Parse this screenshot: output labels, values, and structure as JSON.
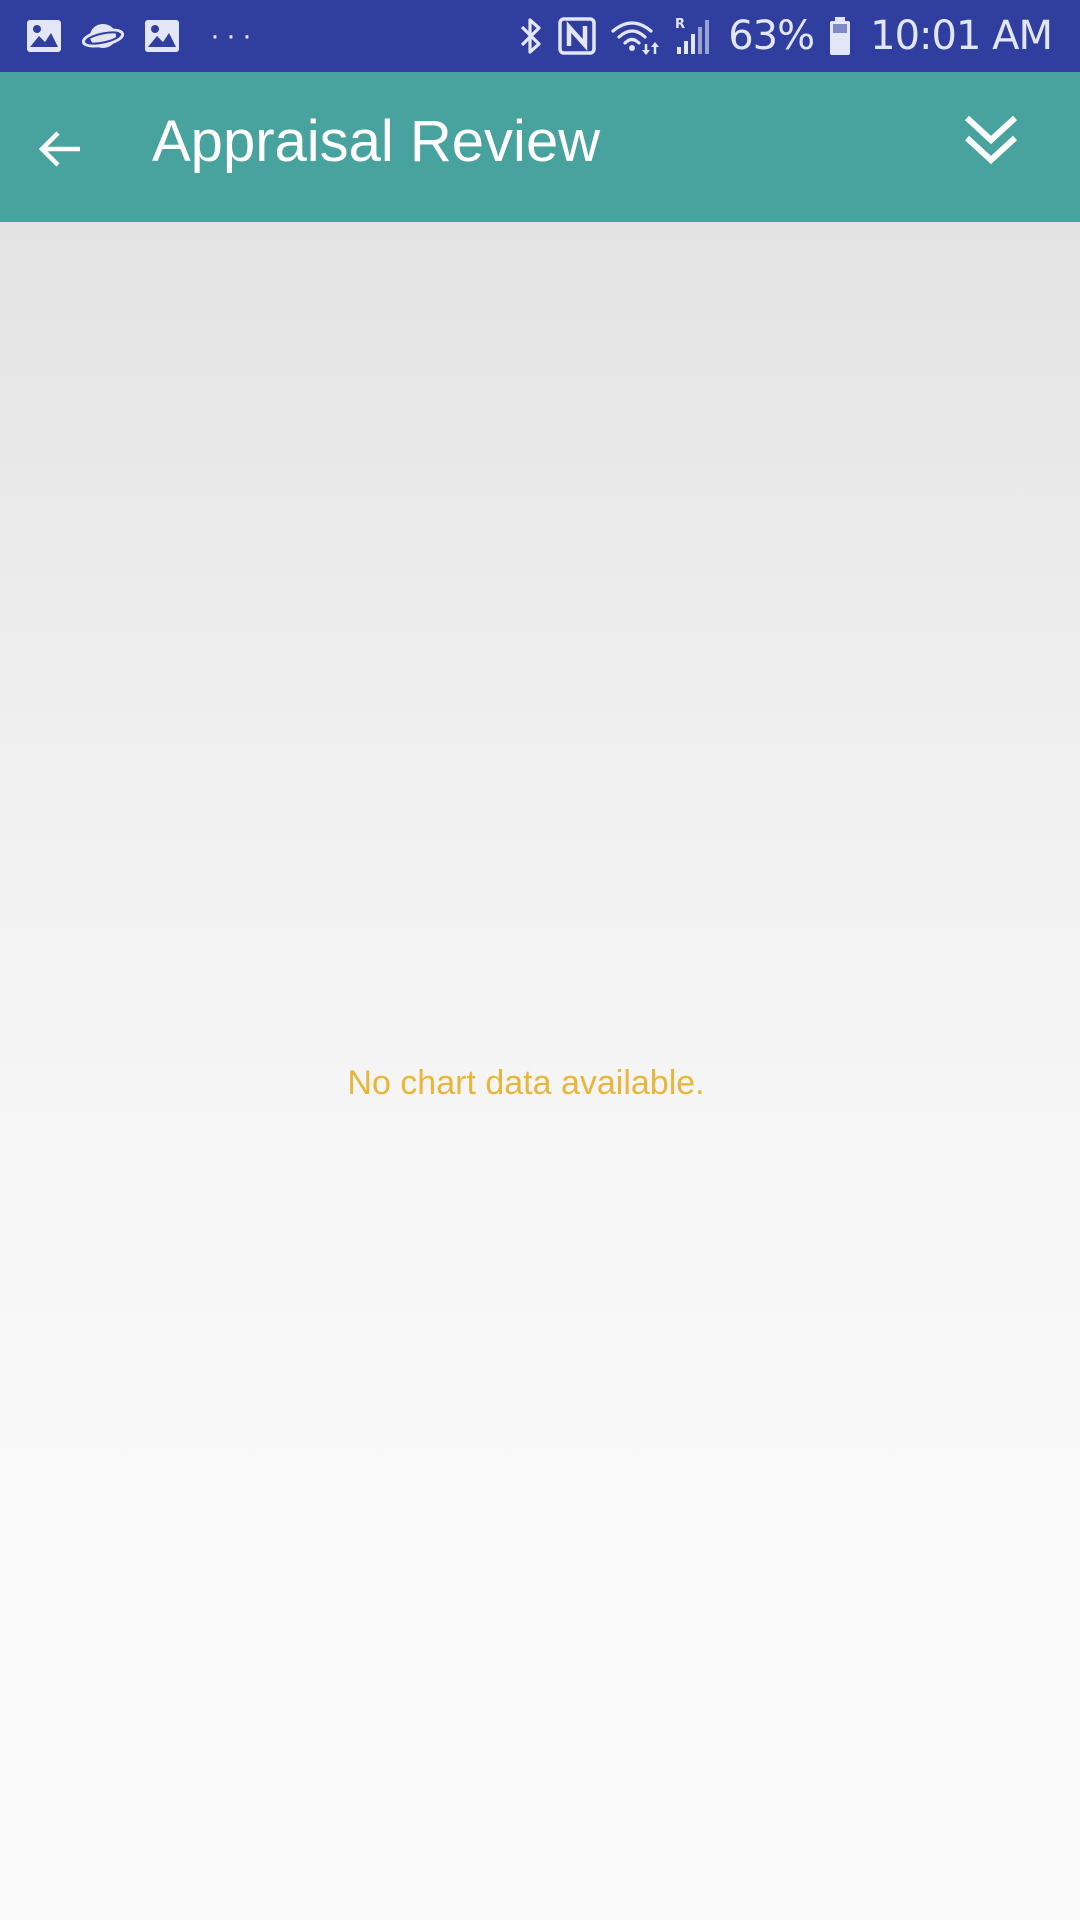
{
  "status_bar": {
    "left_icons": [
      "image-icon",
      "saturn-icon",
      "image-icon"
    ],
    "overflow": "···",
    "right_icons": [
      "bluetooth-icon",
      "nfc-icon",
      "wifi-icon",
      "signal-icon",
      "battery-icon"
    ],
    "battery": "63%",
    "time": "10:01 AM",
    "background_color": "#303f9f"
  },
  "app_bar": {
    "title": "Appraisal Review",
    "back_icon": "arrow-back-icon",
    "action_icon": "double-chevron-down-icon",
    "background_color": "#48a39e"
  },
  "chart": {
    "empty_text": "No chart data available.",
    "empty_text_color": "#e8b73a"
  }
}
